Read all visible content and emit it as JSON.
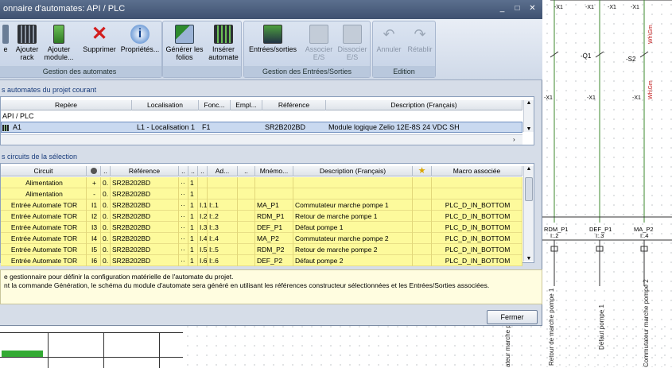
{
  "window": {
    "title": "onnaire d'automates: API / PLC",
    "controls": [
      "_",
      "□",
      "✕"
    ]
  },
  "ribbon": {
    "groups": [
      {
        "label": "Gestion des automates",
        "buttons": [
          {
            "label": "e",
            "icon": "partial-icon",
            "enabled": true
          },
          {
            "label": "Ajouter rack",
            "icon": "rack-icon",
            "enabled": true
          },
          {
            "label": "Ajouter module...",
            "icon": "module-icon",
            "enabled": true
          },
          {
            "label": "Supprimer",
            "icon": "delete-x-icon",
            "enabled": true
          },
          {
            "label": "Propriétés...",
            "icon": "info-icon",
            "enabled": true
          }
        ]
      },
      {
        "label": "",
        "buttons": [
          {
            "label": "Générer les folios",
            "icon": "generate-folios-icon",
            "enabled": true
          },
          {
            "label": "Insérer automate",
            "icon": "insert-plc-icon",
            "enabled": true
          }
        ]
      },
      {
        "label": "Gestion des Entrées/Sorties",
        "buttons": [
          {
            "label": "Entrées/sorties",
            "icon": "io-icon",
            "enabled": true
          },
          {
            "label": "Associer E/S",
            "icon": "associate-io-icon",
            "enabled": false
          },
          {
            "label": "Dissocier E/S",
            "icon": "dissociate-io-icon",
            "enabled": false
          }
        ]
      },
      {
        "label": "Edition",
        "buttons": [
          {
            "label": "Annuler",
            "icon": "undo-icon",
            "enabled": false
          },
          {
            "label": "Rétablir",
            "icon": "redo-icon",
            "enabled": false
          }
        ]
      }
    ]
  },
  "plc_panel": {
    "title": "s automates du projet courant",
    "columns": [
      "Repère",
      "Localisation",
      "Fonc...",
      "Empl...",
      "Référence",
      "Description (Français)"
    ],
    "tree_root": "API / PLC",
    "rows": [
      {
        "repere": "A1",
        "localisation": "L1 - Localisation 1",
        "fonction": "F1",
        "emplacement": "",
        "reference": "SR2B202BD",
        "description": "Module logique Zelio 12E-8S 24 VDC SH"
      }
    ]
  },
  "io_panel": {
    "title": "s circuits de la sélection",
    "columns": [
      "Circuit",
      "",
      "..",
      "Référence",
      "..",
      "..",
      "..",
      "Ad...",
      "..",
      "Mnémo...",
      "Description (Français)",
      "★",
      "Macro associée"
    ],
    "rows": [
      {
        "circuit": "Alimentation",
        "c1": "+",
        "c2": "0.",
        "ref": "SR2B202BD",
        "c4": "··",
        "c5": "1",
        "c6": "",
        "addr": "",
        "c8": "",
        "mnemo": "",
        "desc": "",
        "macro": ""
      },
      {
        "circuit": "Alimentation",
        "c1": "-",
        "c2": "0.",
        "ref": "SR2B202BD",
        "c4": "··",
        "c5": "1",
        "c6": "",
        "addr": "",
        "c8": "",
        "mnemo": "",
        "desc": "",
        "macro": ""
      },
      {
        "circuit": "Entrée Automate TOR",
        "c1": "I1",
        "c2": "0.",
        "ref": "SR2B202BD",
        "c4": "··",
        "c5": "1",
        "c6": "I.1",
        "addr": "I:.1",
        "c8": "",
        "mnemo": "MA_P1",
        "desc": "Commutateur marche pompe 1",
        "macro": "PLC_D_IN_BOTTOM"
      },
      {
        "circuit": "Entrée Automate TOR",
        "c1": "I2",
        "c2": "0.",
        "ref": "SR2B202BD",
        "c4": "··",
        "c5": "1",
        "c6": "I.2",
        "addr": "I:.2",
        "c8": "",
        "mnemo": "RDM_P1",
        "desc": "Retour de marche pompe 1",
        "macro": "PLC_D_IN_BOTTOM"
      },
      {
        "circuit": "Entrée Automate TOR",
        "c1": "I3",
        "c2": "0.",
        "ref": "SR2B202BD",
        "c4": "··",
        "c5": "1",
        "c6": "I.3",
        "addr": "I:.3",
        "c8": "",
        "mnemo": "DEF_P1",
        "desc": "Défaut pompe 1",
        "macro": "PLC_D_IN_BOTTOM"
      },
      {
        "circuit": "Entrée Automate TOR",
        "c1": "I4",
        "c2": "0.",
        "ref": "SR2B202BD",
        "c4": "··",
        "c5": "1",
        "c6": "I.4",
        "addr": "I:.4",
        "c8": "",
        "mnemo": "MA_P2",
        "desc": "Commutateur marche pompe 2",
        "macro": "PLC_D_IN_BOTTOM"
      },
      {
        "circuit": "Entrée Automate TOR",
        "c1": "I5",
        "c2": "0.",
        "ref": "SR2B202BD",
        "c4": "··",
        "c5": "1",
        "c6": "I.5",
        "addr": "I:.5",
        "c8": "",
        "mnemo": "RDM_P2",
        "desc": "Retour de marche pompe 2",
        "macro": "PLC_D_IN_BOTTOM"
      },
      {
        "circuit": "Entrée Automate TOR",
        "c1": "I6",
        "c2": "0.",
        "ref": "SR2B202BD",
        "c4": "··",
        "c5": "1",
        "c6": "I.6",
        "addr": "I:.6",
        "c8": "",
        "mnemo": "DEF_P2",
        "desc": "Défaut pompe 2",
        "macro": "PLC_D_IN_BOTTOM"
      }
    ]
  },
  "status": {
    "line1": "e gestionnaire pour définir la configuration matérielle de l'automate du projet.",
    "line2": "nt la commande Génération, le schéma du module d'automate sera généré en utilisant les références constructeur sélectionnées et les Entrées/Sorties associées."
  },
  "close_button": "Fermer",
  "schematic": {
    "top_labels": [
      "-X1",
      "-X1",
      "-X1",
      "-X1"
    ],
    "mid_labels": [
      "-Q1",
      "-S2"
    ],
    "bottom_labels": [
      "-X1",
      "-X1",
      "-X1",
      "-X1"
    ],
    "terminal_labels": [
      "RDM_P1",
      "DEF_P1",
      "MA_P2"
    ],
    "terminal_addr": [
      "I:.2",
      "I:.3",
      "I:.4"
    ],
    "vertical_texts": [
      "Retour de marche pompe 1",
      "Défaut pompe 1",
      "Commutateur marche pompe 2",
      "ateur marche pompe 1"
    ],
    "wire_labels": [
      "Wh\\Gm",
      "Wh\\Gm"
    ],
    "accent_wire": "#3c8a2e",
    "accent_text": "#c21a1a"
  }
}
